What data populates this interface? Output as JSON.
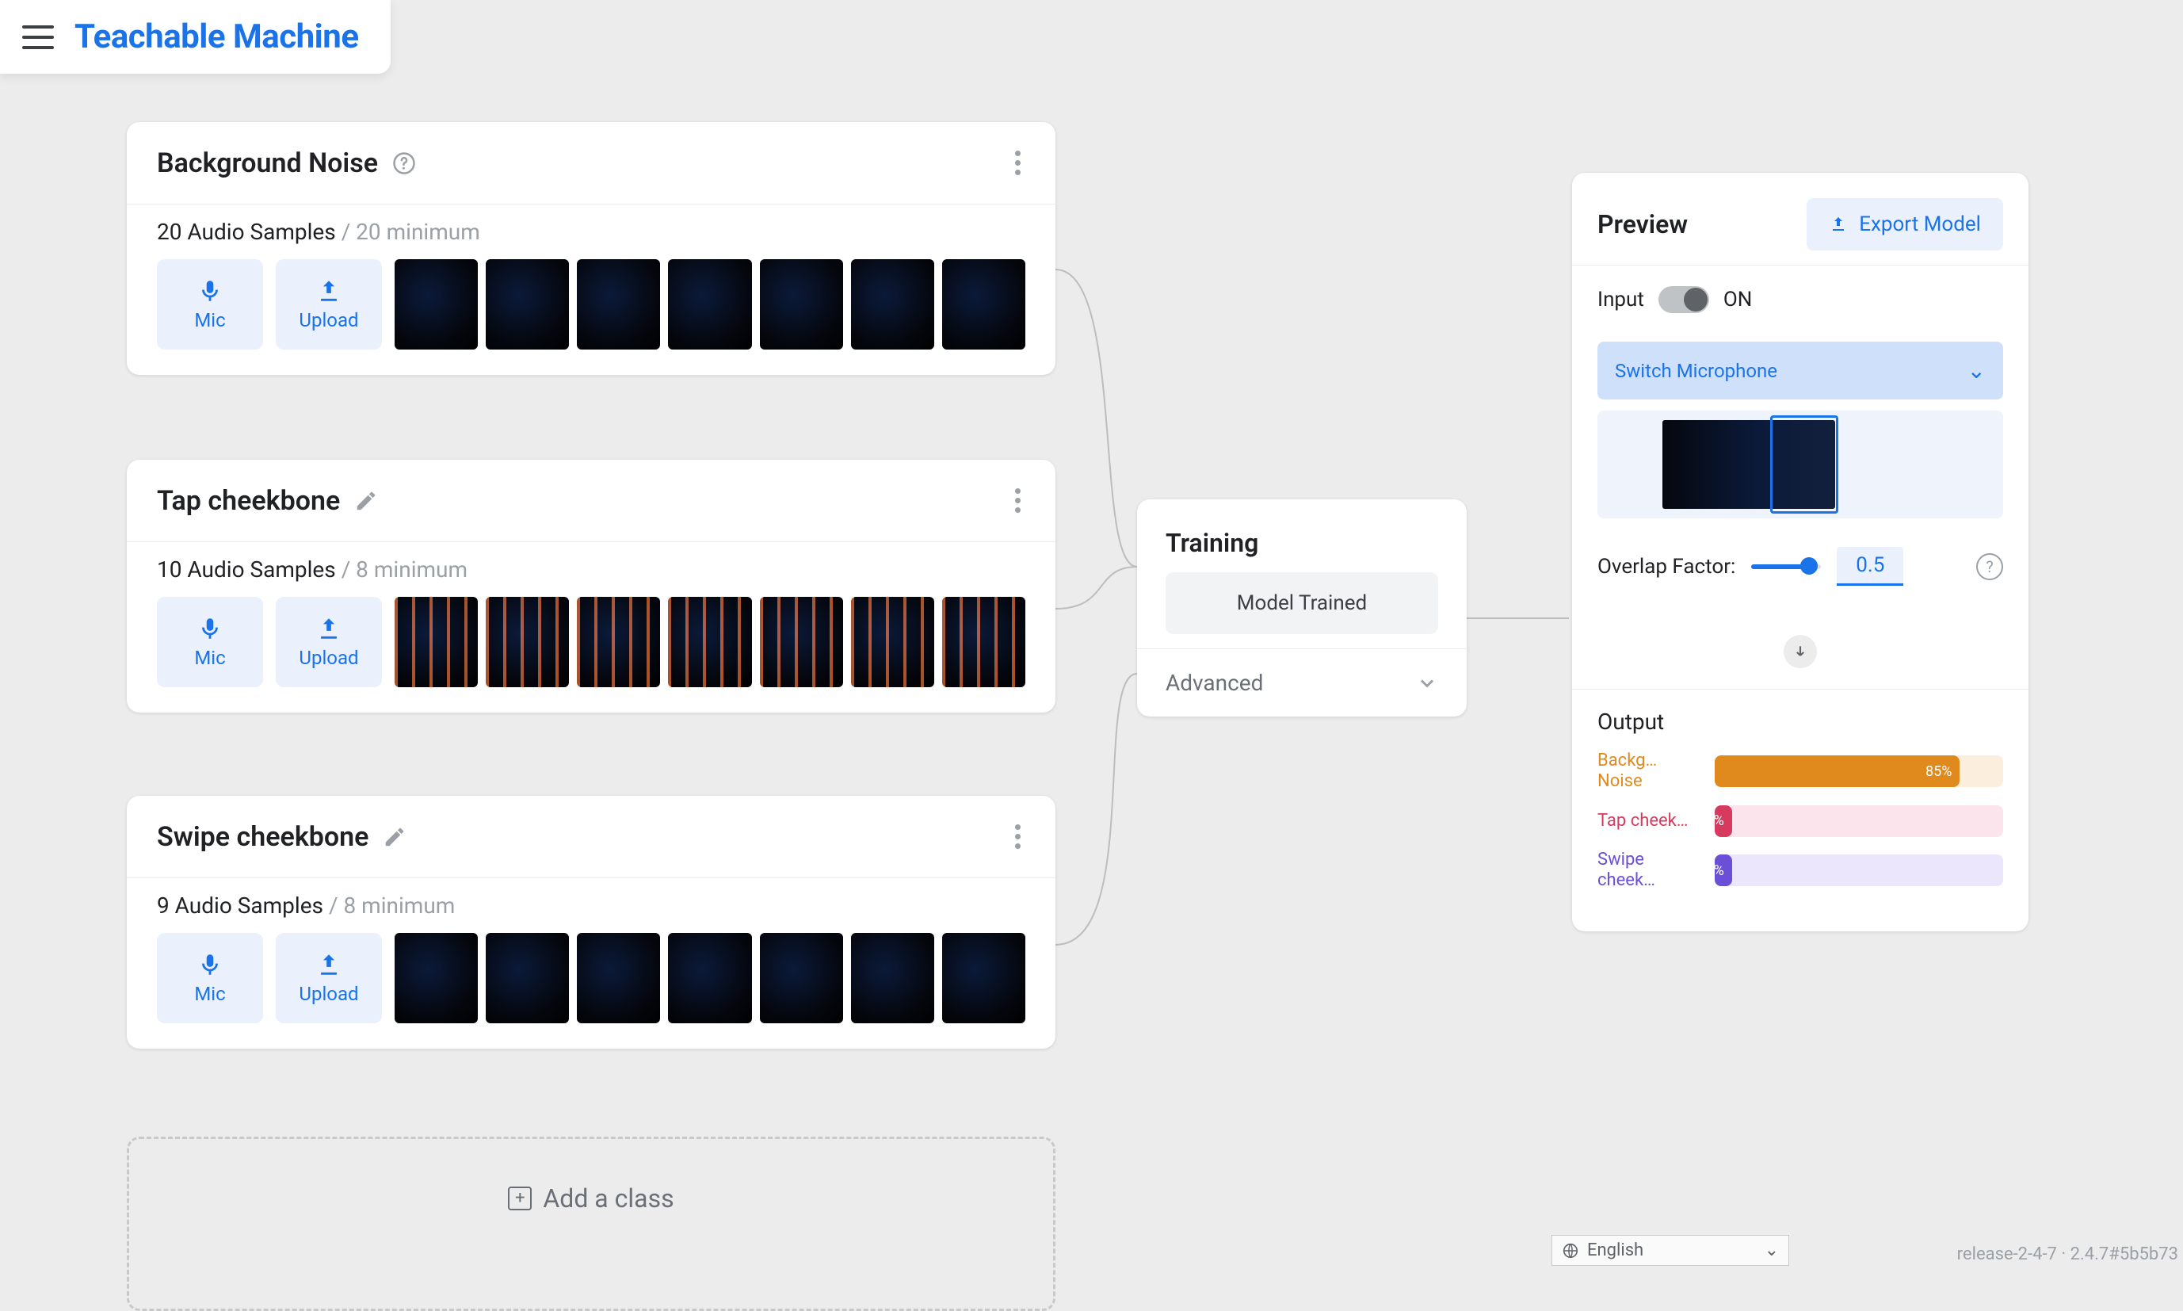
{
  "app": {
    "title": "Teachable Machine"
  },
  "classes": [
    {
      "title": "Background Noise",
      "show_help": true,
      "sample_count": "20 Audio Samples",
      "minimum": "/ 20 minimum",
      "spectro_style": "bg",
      "tools": {
        "mic": "Mic",
        "upload": "Upload"
      }
    },
    {
      "title": "Tap cheekbone",
      "show_edit": true,
      "sample_count": "10 Audio Samples",
      "minimum": "/ 8 minimum",
      "spectro_style": "tap",
      "tools": {
        "mic": "Mic",
        "upload": "Upload"
      }
    },
    {
      "title": "Swipe cheekbone",
      "show_edit": true,
      "sample_count": "9 Audio Samples",
      "minimum": "/ 8 minimum",
      "spectro_style": "bg",
      "tools": {
        "mic": "Mic",
        "upload": "Upload"
      }
    }
  ],
  "add_class_label": "Add a class",
  "training": {
    "title": "Training",
    "status": "Model Trained",
    "advanced": "Advanced"
  },
  "preview": {
    "title": "Preview",
    "export": "Export Model",
    "input_label": "Input",
    "on_label": "ON",
    "mic_switch": "Switch Microphone",
    "overlap_label": "Overlap Factor:",
    "overlap_value": "0.5",
    "output_label": "Output",
    "outputs": [
      {
        "label": "Backg… Noise",
        "pct_text": "85%",
        "pct": 85
      },
      {
        "label": "Tap cheek…",
        "pct_text": "%",
        "pct": 4
      },
      {
        "label": "Swipe cheek…",
        "pct_text": "%",
        "pct": 4
      }
    ]
  },
  "footer": {
    "language": "English",
    "version": "release-2-4-7 · 2.4.7#5b5b73"
  }
}
